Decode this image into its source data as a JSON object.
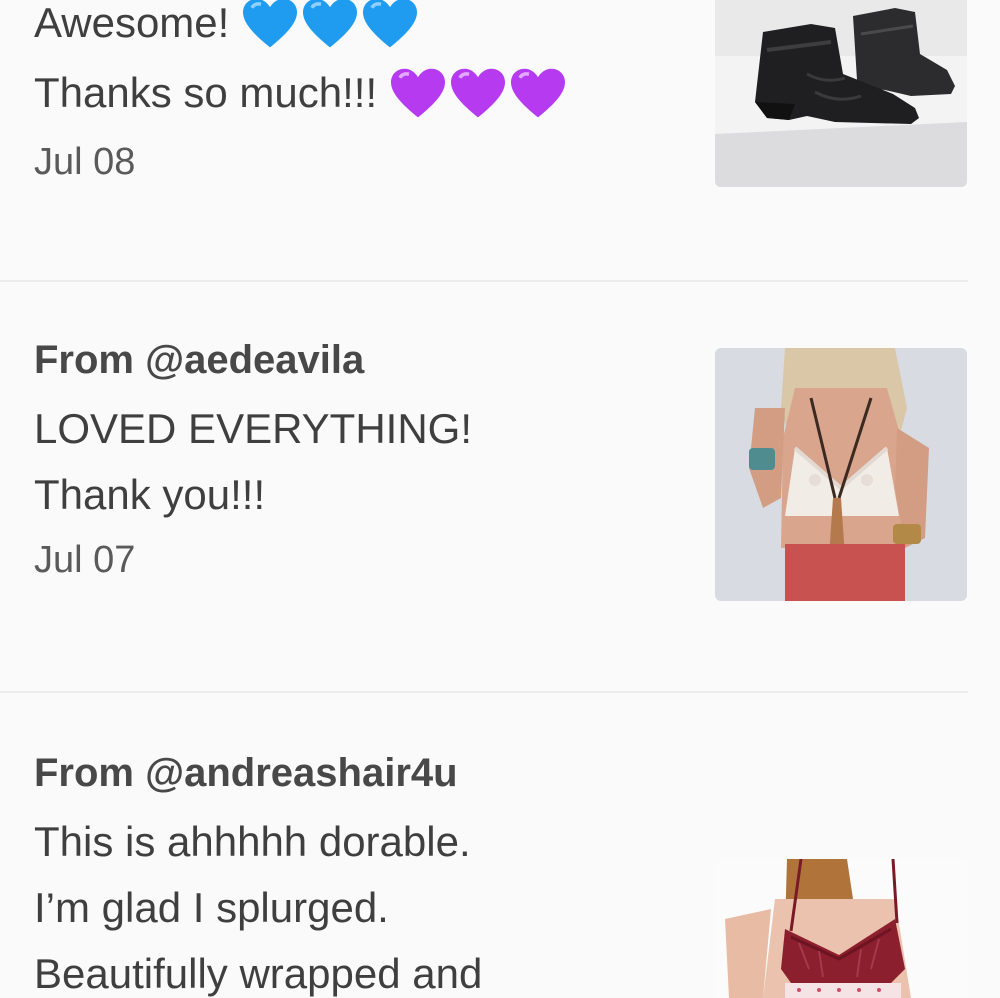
{
  "notes": [
    {
      "message_lines": [
        "Awesome!",
        "Thanks so much!!!"
      ],
      "emoji": [
        "blue-heart",
        "purple-heart"
      ],
      "date": "Jul 08",
      "thumbnail": "black-wedge-ankle-boots-photo"
    },
    {
      "from": "From @aedeavila",
      "message_lines": [
        "LOVED EVERYTHING!",
        "Thank you!!!"
      ],
      "date": "Jul 07",
      "thumbnail": "white-lace-bralette-photo"
    },
    {
      "from": "From @andreashair4u",
      "message_lines": [
        "This is ahhhhh dorable.",
        "I’m glad I splurged.",
        "Beautifully wrapped and"
      ],
      "thumbnail": "burgundy-lace-teddy-photo"
    }
  ],
  "colors": {
    "background": "#fafafa",
    "divider": "#ececec",
    "text": "#444444",
    "blue_heart": "#1f9bf0",
    "purple_heart": "#b63af0"
  }
}
